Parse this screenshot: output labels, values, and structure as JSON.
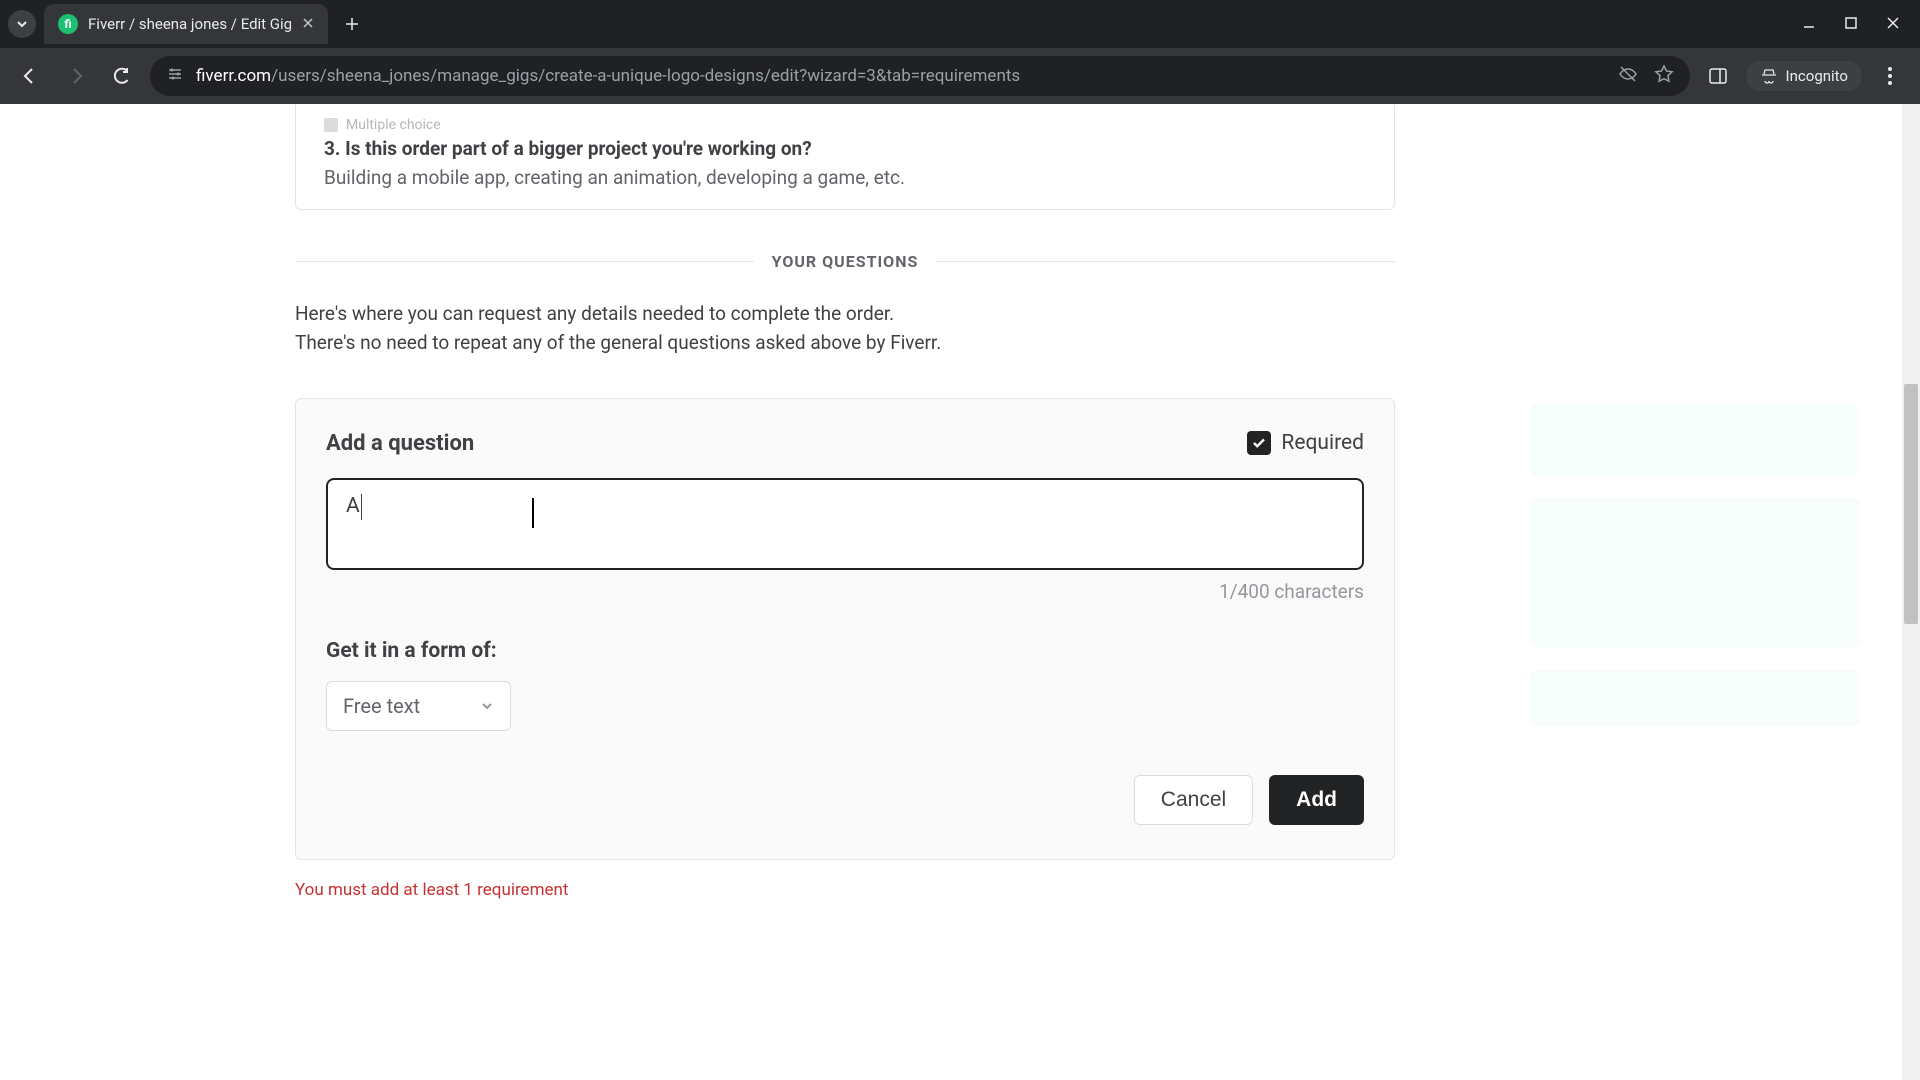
{
  "browser": {
    "tab_title": "Fiverr / sheena jones / Edit Gig",
    "url_domain": "fiverr.com",
    "url_path": "/users/sheena_jones/manage_gigs/create-a-unique-logo-designs/edit?wizard=3&tab=requirements",
    "incognito_label": "Incognito"
  },
  "previous_question": {
    "meta": "Multiple choice",
    "title": "3. Is this order part of a bigger project you're working on?",
    "subtitle": "Building a mobile app, creating an animation, developing a game, etc."
  },
  "section_divider": "YOUR QUESTIONS",
  "intro_line1": "Here's where you can request any details needed to complete the order.",
  "intro_line2": "There's no need to repeat any of the general questions asked above by Fiverr.",
  "form": {
    "title": "Add a question",
    "required_label": "Required",
    "required_checked": true,
    "question_value": "A",
    "char_counter": "1/400 characters",
    "format_label": "Get it in a form of:",
    "select_value": "Free text",
    "cancel_label": "Cancel",
    "add_label": "Add"
  },
  "warning": "You must add at least 1 requirement"
}
